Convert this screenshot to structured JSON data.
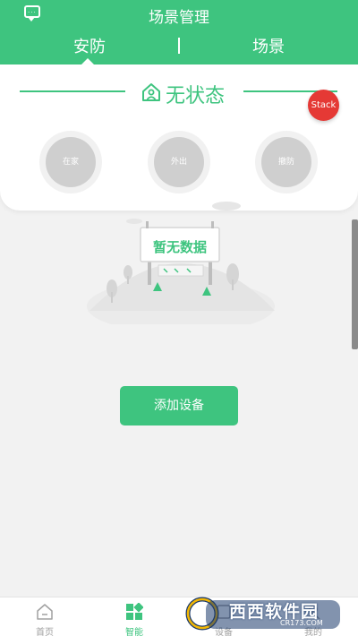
{
  "header": {
    "title": "场景管理",
    "tabs": [
      {
        "label": "安防",
        "active": true
      },
      {
        "label": "场景",
        "active": false
      }
    ]
  },
  "status": {
    "text": "无状态",
    "icon": "home-person-icon"
  },
  "stack_badge": "Stack",
  "modes": [
    {
      "label": "在家"
    },
    {
      "label": "外出"
    },
    {
      "label": "撤防"
    }
  ],
  "empty": {
    "text": "暂无数据"
  },
  "add_device": {
    "label": "添加设备"
  },
  "bottom_nav": {
    "items": [
      {
        "label": "首页",
        "icon": "home-icon",
        "active": false
      },
      {
        "label": "智能",
        "icon": "grid-icon",
        "active": true
      },
      {
        "label": "设备",
        "icon": "device-icon",
        "active": false
      },
      {
        "label": "我的",
        "icon": "user-icon",
        "active": false
      }
    ]
  },
  "watermark": {
    "text": "西西软件园",
    "sub": "CR173.COM"
  },
  "colors": {
    "accent": "#3ec47f",
    "badge": "#e53935",
    "mode_button": "#cfcfcf"
  }
}
